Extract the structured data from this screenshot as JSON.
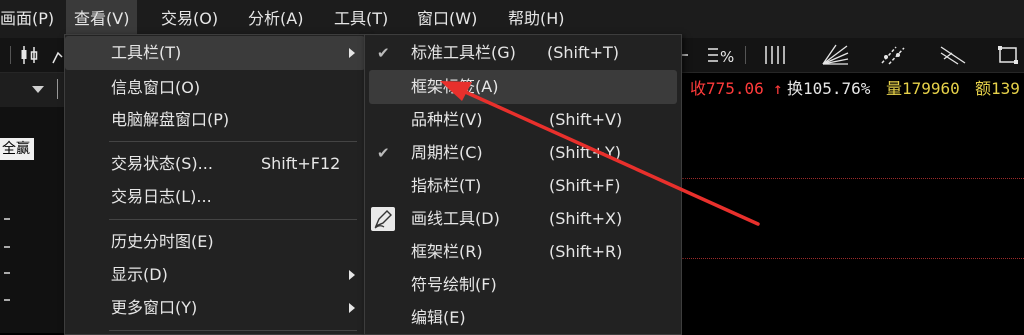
{
  "menubar": {
    "items": [
      "画面(P)",
      "查看(V)",
      "交易(O)",
      "分析(A)",
      "工具(T)",
      "窗口(W)",
      "帮助(H)"
    ]
  },
  "left": {
    "badge": "全赢"
  },
  "quote": {
    "close": "收775.06",
    "up_arrow": "↑",
    "turnover": "换105.76%",
    "volume": "量179960",
    "amount": "额139"
  },
  "view_menu": {
    "items": [
      {
        "label": "工具栏(T)",
        "shortcut": "",
        "submenu": true
      },
      {
        "label": "信息窗口(O)",
        "shortcut": "",
        "submenu": false
      },
      {
        "label": "电脑解盘窗口(P)",
        "shortcut": "",
        "submenu": false
      },
      {
        "label": "交易状态(S)...",
        "shortcut": "Shift+F12",
        "submenu": false
      },
      {
        "label": "交易日志(L)...",
        "shortcut": "",
        "submenu": false
      },
      {
        "label": "历史分时图(E)",
        "shortcut": "",
        "submenu": false
      },
      {
        "label": "显示(D)",
        "shortcut": "",
        "submenu": true
      },
      {
        "label": "更多窗口(Y)",
        "shortcut": "",
        "submenu": true
      }
    ]
  },
  "toolbar_menu": {
    "items": [
      {
        "label": "标准工具栏(G)",
        "shortcut": "(Shift+T)",
        "checked": true
      },
      {
        "label": "框架标签(A)",
        "shortcut": "",
        "checked": false
      },
      {
        "label": "品种栏(V)",
        "shortcut": "(Shift+V)",
        "checked": false
      },
      {
        "label": "周期栏(C)",
        "shortcut": "(Shift+Y)",
        "checked": true
      },
      {
        "label": "指标栏(T)",
        "shortcut": "(Shift+F)",
        "checked": false
      },
      {
        "label": "画线工具(D)",
        "shortcut": "(Shift+X)",
        "checked": false
      },
      {
        "label": "框架栏(R)",
        "shortcut": "(Shift+R)",
        "checked": false
      },
      {
        "label": "符号绘制(F)",
        "shortcut": "",
        "checked": false
      },
      {
        "label": "编辑(E)",
        "shortcut": "",
        "checked": false
      }
    ]
  },
  "toolbar_right": {
    "percent_icon_text": "%"
  },
  "colors": {
    "menu_bg": "#222222",
    "highlight": "#3b3b3b",
    "price_red": "#ff3b3b",
    "volume_yellow": "#e6d14a",
    "arrow_red": "#e8302c"
  }
}
